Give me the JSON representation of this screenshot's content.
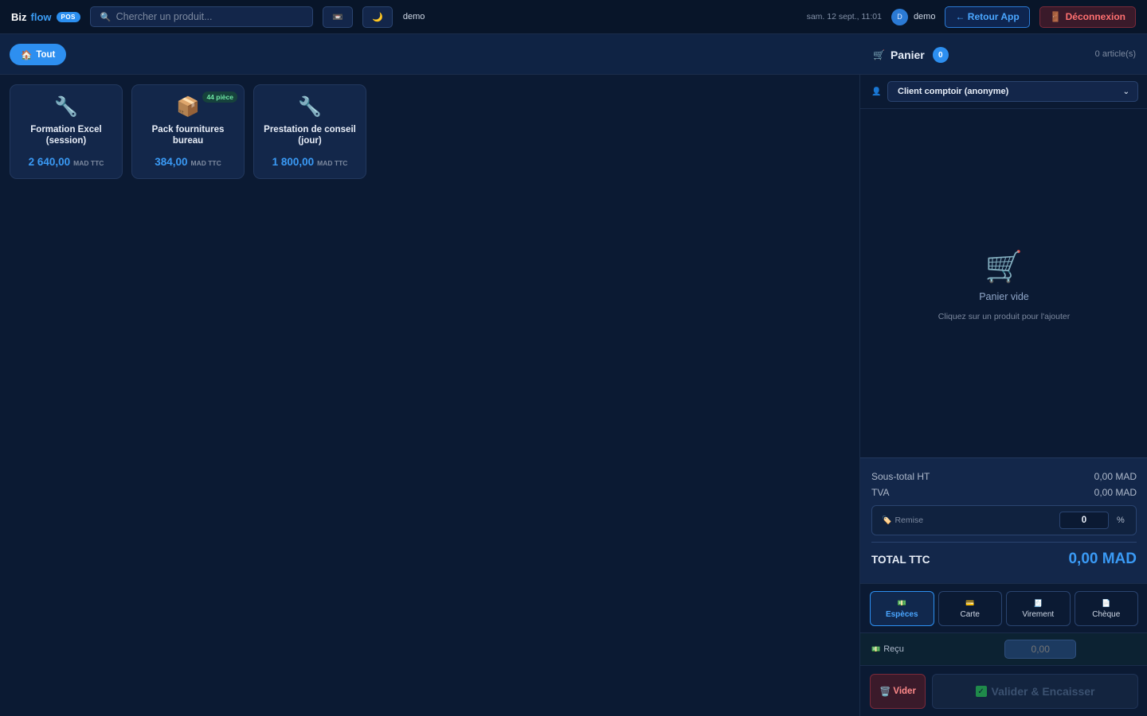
{
  "topbar": {
    "brand_biz": "Biz",
    "brand_flow": "flow",
    "brand_badge": "POS",
    "search_placeholder": "Chercher un produit...",
    "search_icon": "🔍",
    "register_icon": "📼",
    "theme_icon": "🌙",
    "user_short": "demo",
    "datetime": "sam. 12 sept., 11:01",
    "avatar_letter": "D",
    "user_name": "demo",
    "back_label": "← Retour App",
    "logout_icon": "🚪",
    "logout_label": "Déconnexion"
  },
  "categories": {
    "all_icon": "🏠",
    "all_label": "Tout"
  },
  "products": [
    {
      "name": "Formation Excel (session)",
      "price": "2 640,00",
      "currency": "MAD TTC",
      "icon": "🔧",
      "stock": ""
    },
    {
      "name": "Pack fournitures bureau",
      "price": "384,00",
      "currency": "MAD TTC",
      "icon": "📦",
      "stock": "44 pièce"
    },
    {
      "name": "Prestation de conseil (jour)",
      "price": "1 800,00",
      "currency": "MAD TTC",
      "icon": "🔧",
      "stock": ""
    }
  ],
  "cart": {
    "icon": "🛒",
    "title": "Panier",
    "count": "0",
    "articles": "0 article(s)",
    "client_icon": "👤",
    "client_selected": "Client comptoir (anonyme)",
    "empty_icon": "🛒",
    "empty_title": "Panier vide",
    "empty_hint": "Cliquez sur un produit pour l'ajouter"
  },
  "totals": {
    "subtotal_label": "Sous-total HT",
    "subtotal_value": "0,00 MAD",
    "tva_label": "TVA",
    "tva_value": "0,00 MAD",
    "discount_icon": "🏷️",
    "discount_label": "Remise",
    "discount_value": "0",
    "discount_unit": "%",
    "total_label": "TOTAL TTC",
    "total_value": "0,00 MAD"
  },
  "payment": {
    "methods": [
      {
        "icon": "💵",
        "label": "Espèces",
        "active": true
      },
      {
        "icon": "💳",
        "label": "Carte",
        "active": false
      },
      {
        "icon": "🧾",
        "label": "Virement",
        "active": false
      },
      {
        "icon": "📄",
        "label": "Chèque",
        "active": false
      }
    ],
    "received_icon": "💵",
    "received_label": "Reçu",
    "received_placeholder": "0,00"
  },
  "actions": {
    "clear_icon": "🗑️",
    "clear_label": "Vider",
    "validate_icon": "✓",
    "validate_label": "Valider & Encaisser"
  },
  "colors": {
    "accent": "#2d8ff0",
    "background": "#0b1a33",
    "danger": "#ff7070",
    "success": "#6ee7a5"
  }
}
